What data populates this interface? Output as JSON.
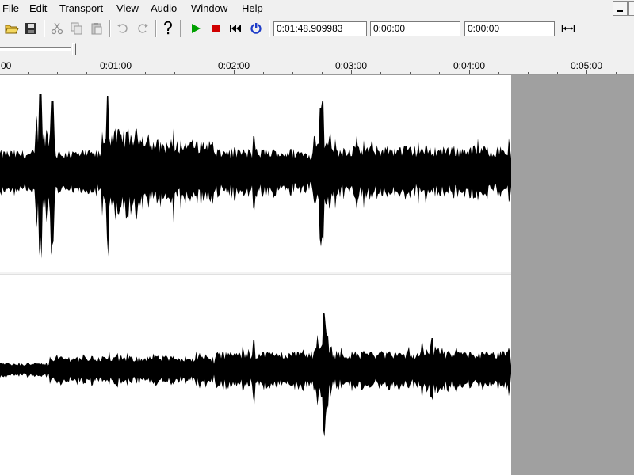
{
  "menu": {
    "file": "File",
    "edit": "Edit",
    "transport": "Transport",
    "view": "View",
    "audio": "Audio",
    "window": "Window",
    "help": "Help"
  },
  "toolbar": {
    "icons": [
      "open-folder-icon",
      "save-icon",
      "cut-icon",
      "copy-icon",
      "paste-icon",
      "undo-icon",
      "redo-icon",
      "help-icon",
      "play-icon",
      "stop-icon",
      "rewind-icon",
      "loop-icon",
      "fit-width-icon"
    ],
    "position_field": "0:01:48.909983",
    "selection_start": "0:00:00",
    "selection_end": "0:00:00",
    "colors": {
      "play": "#00a000",
      "stop": "#d00000",
      "loop": "#1e3cc8"
    }
  },
  "timeline": {
    "labels": [
      ":00",
      "0:01:00",
      "0:02:00",
      "0:03:00",
      "0:04:00",
      "0:05:00"
    ],
    "cursor_time": "0:01:48.909983"
  },
  "tracks": {
    "count": 2,
    "waveform_color": "#000000",
    "empty_area_color": "#a0a0a0"
  }
}
